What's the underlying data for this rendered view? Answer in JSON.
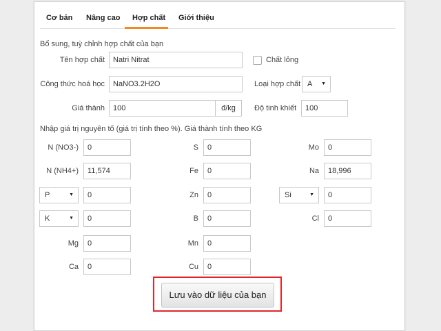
{
  "tabs": [
    "Cơ bản",
    "Nâng cao",
    "Hợp chất",
    "Giới thiệu"
  ],
  "intro_text": "Bổ sung, tuỳ chỉnh hợp chất của bạn",
  "compound": {
    "name_label": "Tên hợp chất",
    "name_value": "Natri Nitrat",
    "liquid_label": "Chất lỏng",
    "formula_label": "Công thức hoá học",
    "formula_value": "NaNO3.2H2O",
    "type_label": "Loại hợp chất",
    "type_value": "A",
    "price_label": "Giá thành",
    "price_value": "100",
    "price_unit": "đ/kg",
    "purity_label": "Độ tinh khiết",
    "purity_value": "100"
  },
  "elements_note": "Nhập giá trị nguyên tố (giá trị tính theo %). Giá thành tính theo KG",
  "elements": {
    "n_no3": {
      "label": "N (NO3-)",
      "value": "0"
    },
    "n_nh4": {
      "label": "N (NH4+)",
      "value": "11,574"
    },
    "p": {
      "label": "P",
      "value": "0"
    },
    "k": {
      "label": "K",
      "value": "0"
    },
    "mg": {
      "label": "Mg",
      "value": "0"
    },
    "ca": {
      "label": "Ca",
      "value": "0"
    },
    "s": {
      "label": "S",
      "value": "0"
    },
    "fe": {
      "label": "Fe",
      "value": "0"
    },
    "zn": {
      "label": "Zn",
      "value": "0"
    },
    "b": {
      "label": "B",
      "value": "0"
    },
    "mn": {
      "label": "Mn",
      "value": "0"
    },
    "cu": {
      "label": "Cu",
      "value": "0"
    },
    "mo": {
      "label": "Mo",
      "value": "0"
    },
    "na": {
      "label": "Na",
      "value": "18,996"
    },
    "si": {
      "label": "Si",
      "value": "0"
    },
    "cl": {
      "label": "Cl",
      "value": "0"
    }
  },
  "save_button": "Lưu vào dữ liệu của bạn",
  "colors": {
    "accent": "#f5891f",
    "highlight_border": "#e0262b"
  }
}
